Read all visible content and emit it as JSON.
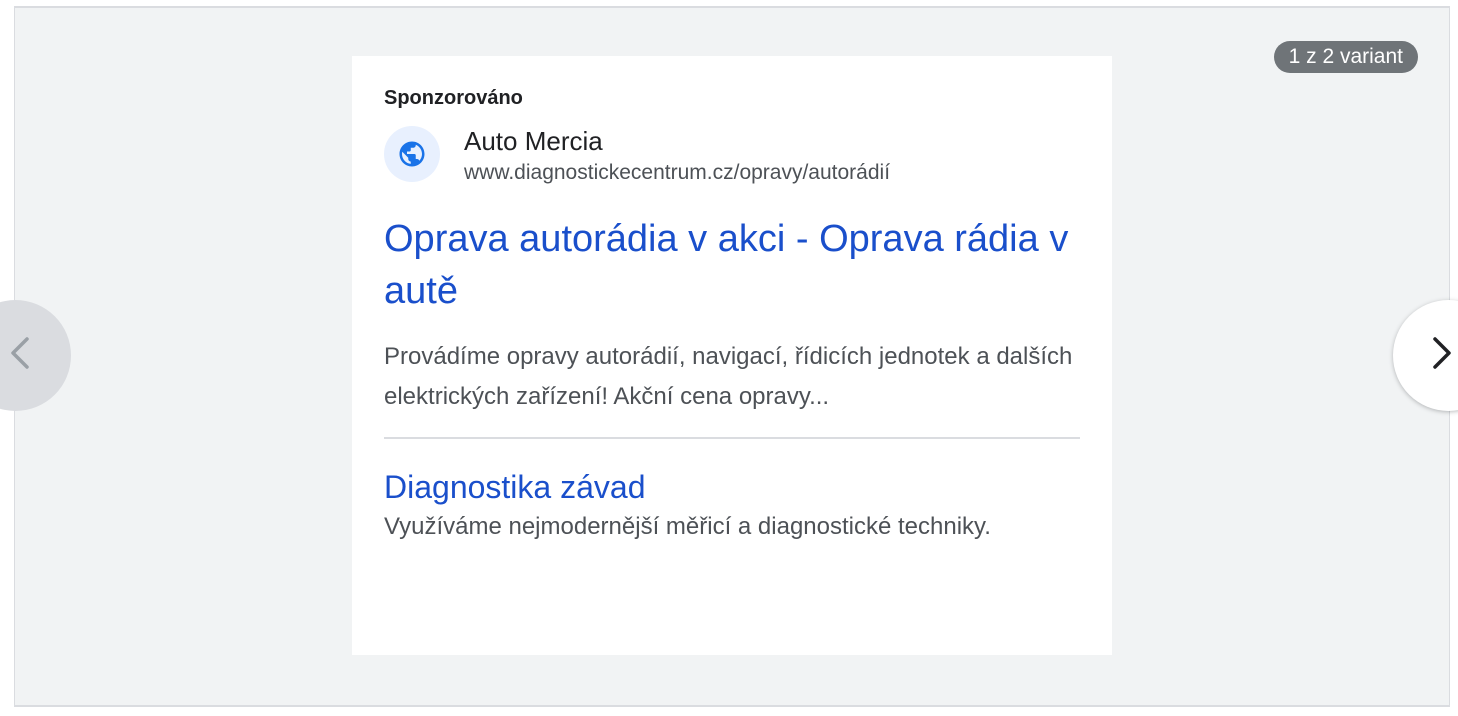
{
  "badge": {
    "variant_text": "1 z 2 variant"
  },
  "ad": {
    "sponsored_label": "Sponzorováno",
    "advertiser_name": "Auto Mercia",
    "display_url": "www.diagnostickecentrum.cz/opravy/autorádií",
    "headline": "Oprava autorádia v akci - Oprava rádia v autě",
    "description": "Provádíme opravy autorádií, navigací, řídicích jednotek a dalších elektrických zařízení! Akční cena opravy...",
    "sitelink": {
      "title": "Diagnostika závad",
      "description": "Využíváme nejmodernější měřicí a diagnostické techniky."
    }
  },
  "icons": {
    "advertiser": "globe-icon",
    "prev": "chevron-left-icon",
    "next": "chevron-right-icon"
  },
  "colors": {
    "link_blue": "#1a4fcb",
    "badge_bg": "#6f7478",
    "globe_blue": "#1a73e8",
    "globe_bg": "#e8f0fe",
    "preview_bg": "#f1f3f4"
  }
}
